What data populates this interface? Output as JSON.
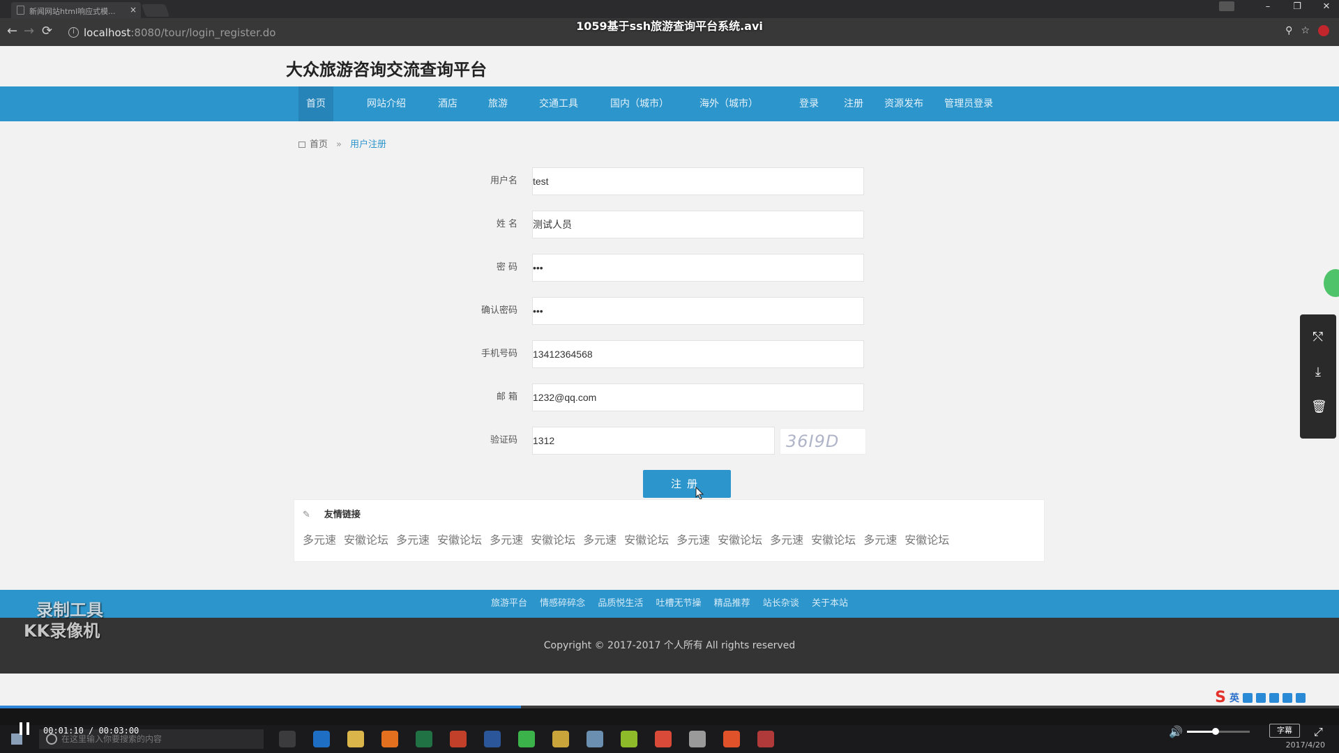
{
  "browser": {
    "tab_title": "新闻网站html响应式模...",
    "tab_close": "×",
    "nav_back": "←",
    "nav_forward": "→",
    "nav_reload": "⟳",
    "url_host": "localhost",
    "url_path": ":8080/tour/login_register.do",
    "win_min": "–",
    "win_max": "❐",
    "win_close": "✕",
    "key_icon": "⚲",
    "star_icon": "☆"
  },
  "video_title": "1059基于ssh旅游查询平台系统.avi",
  "site": {
    "title": "大众旅游咨询交流查询平台"
  },
  "nav": {
    "items": [
      {
        "label": "首页"
      },
      {
        "label": "网站介绍"
      },
      {
        "label": "酒店"
      },
      {
        "label": "旅游"
      },
      {
        "label": "交通工具"
      },
      {
        "label": "国内（城市）"
      },
      {
        "label": "海外（城市）"
      },
      {
        "label": "登录"
      },
      {
        "label": "注册"
      },
      {
        "label": "资源发布"
      },
      {
        "label": "管理员登录"
      }
    ]
  },
  "breadcrumb": {
    "home": "首页",
    "sep": "»",
    "current": "用户注册"
  },
  "form": {
    "username_label": "用户名",
    "username_value": "test",
    "realname_label": "姓  名",
    "realname_value": "测试人员",
    "password_label": "密  码",
    "password_value": "•••",
    "confirm_label": "确认密码",
    "confirm_value": "•••",
    "phone_label": "手机号码",
    "phone_value": "13412364568",
    "email_label": "邮  箱",
    "email_value": "1232@qq.com",
    "captcha_label": "验证码",
    "captcha_value": "1312",
    "captcha_image_text": "36I9D",
    "submit_label": "注册"
  },
  "links": {
    "heading": "友情链接",
    "items": [
      "多元速",
      "安徽论坛",
      "多元速",
      "安徽论坛",
      "多元速",
      "安徽论坛",
      "多元速",
      "安徽论坛",
      "多元速",
      "安徽论坛",
      "多元速",
      "安徽论坛",
      "多元速",
      "安徽论坛"
    ]
  },
  "footer": {
    "links": [
      "旅游平台",
      "情感碎碎念",
      "品质悦生活",
      "吐槽无节操",
      "精品推荐",
      "站长杂谈",
      "关于本站"
    ],
    "copyright": "Copyright © 2017-2017 个人所有 All rights reserved"
  },
  "watermark": {
    "line1": "录制工具",
    "line2": "KK录像机"
  },
  "side_panel": {
    "share_icon": "⤲",
    "download_icon": "⤓",
    "delete_icon": "🗑"
  },
  "ime": {
    "logo": "S",
    "mode": "英"
  },
  "player": {
    "time": "00:01:10 / 00:03:00",
    "progress": 0.389,
    "volume_icon": "🔊",
    "subtitle": "字幕",
    "fullscreen_icon": "⤢"
  },
  "taskbar": {
    "search_placeholder": "在这里输入你要搜索的内容",
    "date": "2017/4/20"
  }
}
